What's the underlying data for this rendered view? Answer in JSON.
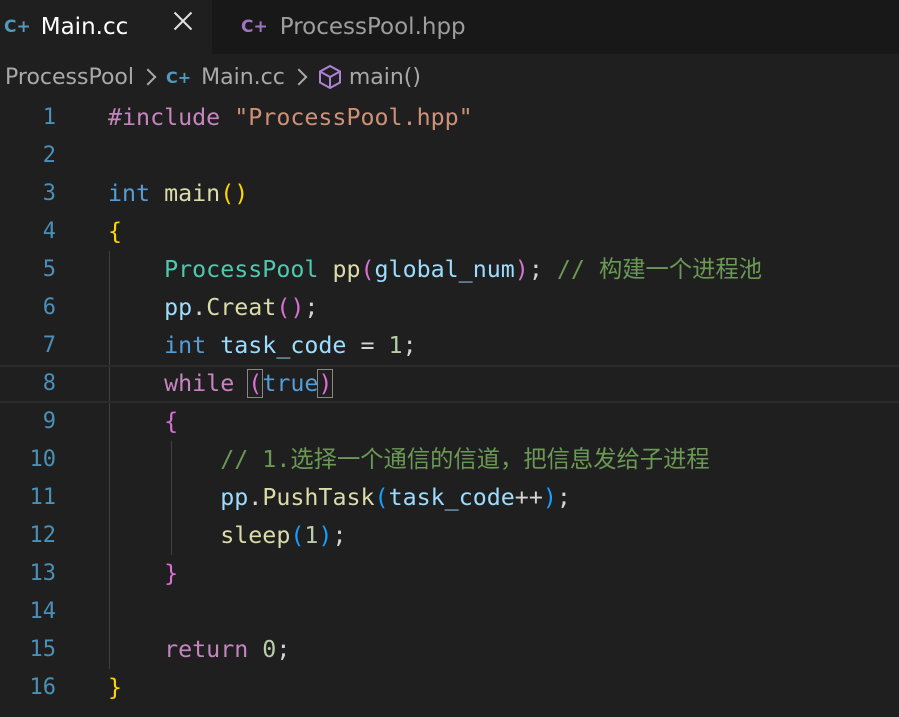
{
  "tabs": [
    {
      "icon": "C+",
      "label": "Main.cc",
      "active": true
    },
    {
      "icon": "C+",
      "label": "ProcessPool.hpp",
      "active": false
    }
  ],
  "breadcrumb": {
    "folder": "ProcessPool",
    "file_icon": "C+",
    "file": "Main.cc",
    "symbol": "main()"
  },
  "line_numbers": [
    "1",
    "2",
    "3",
    "4",
    "5",
    "6",
    "7",
    "8",
    "9",
    "10",
    "11",
    "12",
    "13",
    "14",
    "15",
    "16"
  ],
  "code": {
    "l1_directive": "#include",
    "l1_string": "\"ProcessPool.hpp\"",
    "l3_type": "int",
    "l3_fn": "main",
    "l5_type": "ProcessPool",
    "l5_var": "pp",
    "l5_arg": "global_num",
    "l5_comment": "// 构建一个进程池",
    "l6_var": "pp",
    "l6_fn": "Creat",
    "l7_type": "int",
    "l7_var": "task_code",
    "l7_num": "1",
    "l8_kw": "while",
    "l8_val": "true",
    "l10_comment": "// 1.选择一个通信的信道，把信息发给子进程",
    "l11_var": "pp",
    "l11_fn": "PushTask",
    "l11_arg": "task_code",
    "l12_fn": "sleep",
    "l12_num": "1",
    "l15_kw": "return",
    "l15_num": "0"
  }
}
